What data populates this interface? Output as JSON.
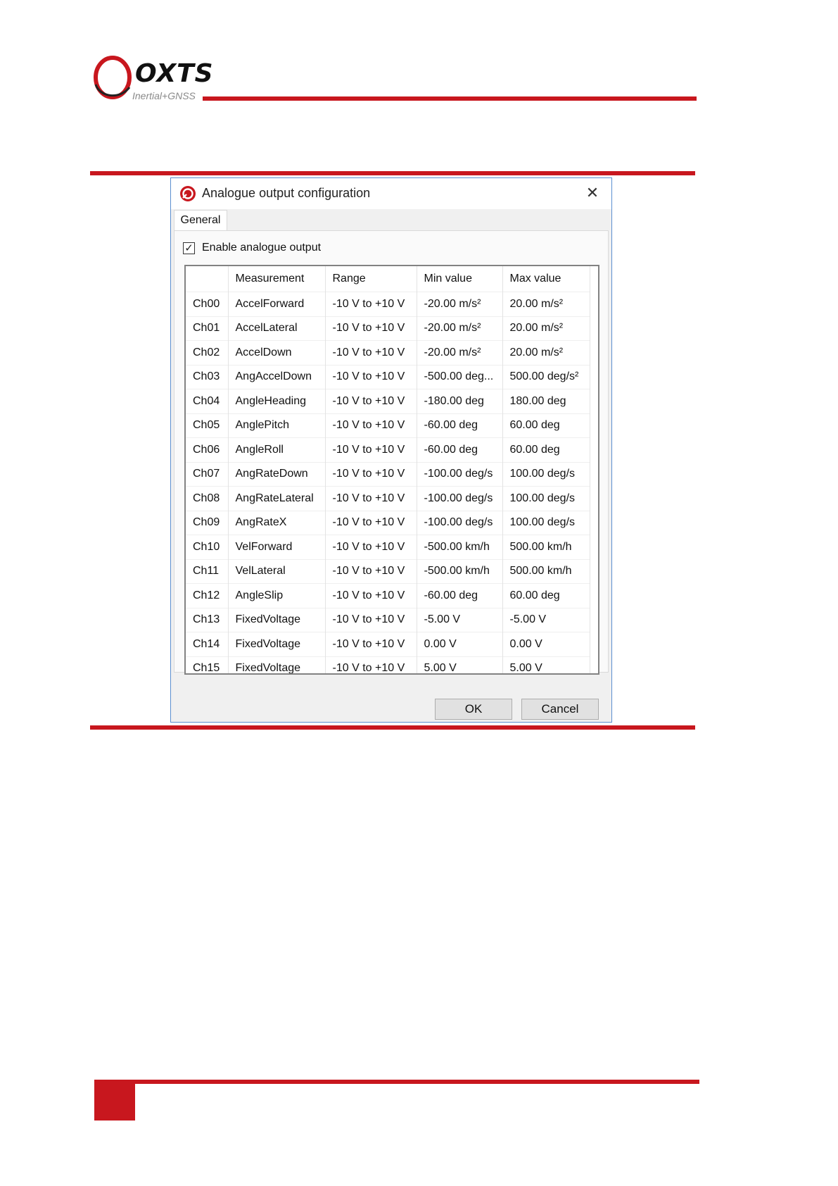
{
  "brand": {
    "logo_text": "OXTS",
    "tagline": "Inertial+GNSS",
    "accent_color": "#c8171e"
  },
  "dialog": {
    "title": "Analogue output configuration",
    "app_icon": "oxts-app-icon",
    "close_icon": "close-icon",
    "tabs": [
      {
        "label": "General",
        "selected": true
      }
    ],
    "enable_checkbox": {
      "label": "Enable analogue output",
      "checked": true
    },
    "table": {
      "columns": [
        "",
        "Measurement",
        "Range",
        "Min value",
        "Max value"
      ],
      "rows": [
        [
          "Ch00",
          "AccelForward",
          "-10 V to +10 V",
          "-20.00 m/s²",
          "20.00 m/s²"
        ],
        [
          "Ch01",
          "AccelLateral",
          "-10 V to +10 V",
          "-20.00 m/s²",
          "20.00 m/s²"
        ],
        [
          "Ch02",
          "AccelDown",
          "-10 V to +10 V",
          "-20.00 m/s²",
          "20.00 m/s²"
        ],
        [
          "Ch03",
          "AngAccelDown",
          "-10 V to +10 V",
          "-500.00 deg...",
          "500.00 deg/s²"
        ],
        [
          "Ch04",
          "AngleHeading",
          "-10 V to +10 V",
          "-180.00 deg",
          "180.00 deg"
        ],
        [
          "Ch05",
          "AnglePitch",
          "-10 V to +10 V",
          "-60.00 deg",
          "60.00 deg"
        ],
        [
          "Ch06",
          "AngleRoll",
          "-10 V to +10 V",
          "-60.00 deg",
          "60.00 deg"
        ],
        [
          "Ch07",
          "AngRateDown",
          "-10 V to +10 V",
          "-100.00 deg/s",
          "100.00 deg/s"
        ],
        [
          "Ch08",
          "AngRateLateral",
          "-10 V to +10 V",
          "-100.00 deg/s",
          "100.00 deg/s"
        ],
        [
          "Ch09",
          "AngRateX",
          "-10 V to +10 V",
          "-100.00 deg/s",
          "100.00 deg/s"
        ],
        [
          "Ch10",
          "VelForward",
          "-10 V to +10 V",
          "-500.00 km/h",
          "500.00 km/h"
        ],
        [
          "Ch11",
          "VelLateral",
          "-10 V to +10 V",
          "-500.00 km/h",
          "500.00 km/h"
        ],
        [
          "Ch12",
          "AngleSlip",
          "-10 V to +10 V",
          "-60.00 deg",
          "60.00 deg"
        ],
        [
          "Ch13",
          "FixedVoltage",
          "-10 V to +10 V",
          "-5.00 V",
          "-5.00 V"
        ],
        [
          "Ch14",
          "FixedVoltage",
          "-10 V to +10 V",
          "0.00 V",
          "0.00 V"
        ],
        [
          "Ch15",
          "FixedVoltage",
          "-10 V to +10 V",
          "5.00 V",
          "5.00 V"
        ]
      ]
    },
    "buttons": {
      "ok": "OK",
      "cancel": "Cancel"
    }
  }
}
